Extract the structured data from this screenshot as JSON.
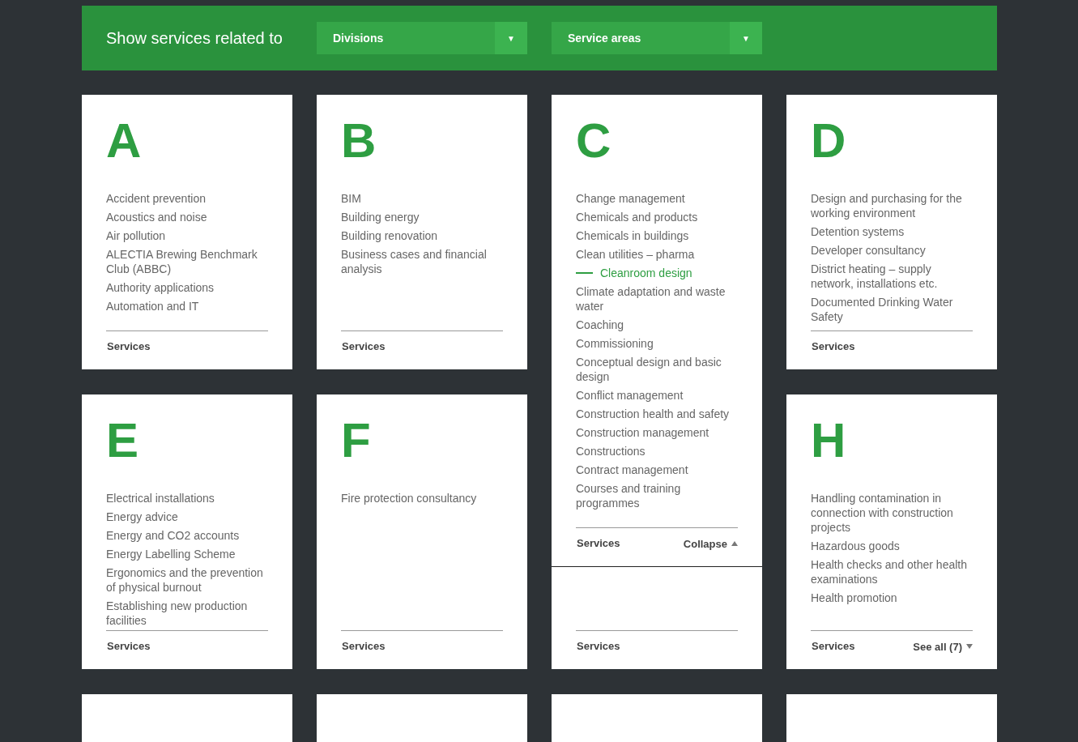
{
  "filter_bar": {
    "title": "Show services related to",
    "dropdowns": [
      {
        "label": "Divisions",
        "arrow": "▼"
      },
      {
        "label": "Service areas",
        "arrow": "▼"
      }
    ]
  },
  "cards": [
    {
      "letter": "A",
      "items": [
        {
          "label": "Accident prevention",
          "selected": false
        },
        {
          "label": "Acoustics and noise",
          "selected": false
        },
        {
          "label": "Air pollution",
          "selected": false
        },
        {
          "label": "ALECTIA Brewing Benchmark Club (ABBC)",
          "selected": false
        },
        {
          "label": "Authority applications",
          "selected": false
        },
        {
          "label": "Automation and IT",
          "selected": false
        }
      ],
      "footer": {
        "link": "Services"
      }
    },
    {
      "letter": "B",
      "items": [
        {
          "label": "BIM",
          "selected": false
        },
        {
          "label": "Building energy",
          "selected": false
        },
        {
          "label": "Building renovation",
          "selected": false
        },
        {
          "label": "Business cases and financial analysis",
          "selected": false
        }
      ],
      "footer": {
        "link": "Services"
      }
    },
    {
      "letter": "C",
      "items": [
        {
          "label": "Change management",
          "selected": false
        },
        {
          "label": "Chemicals and products",
          "selected": false
        },
        {
          "label": "Chemicals in buildings",
          "selected": false
        },
        {
          "label": "Clean utilities – pharma",
          "selected": false
        },
        {
          "label": "Cleanroom design",
          "selected": true
        },
        {
          "label": "Climate adaptation and waste water",
          "selected": false
        },
        {
          "label": "Coaching",
          "selected": false
        },
        {
          "label": "Commissioning",
          "selected": false
        },
        {
          "label": "Conceptual design and basic design",
          "selected": false
        },
        {
          "label": "Conflict management",
          "selected": false
        },
        {
          "label": "Construction health and safety",
          "selected": false
        },
        {
          "label": "Construction management",
          "selected": false
        },
        {
          "label": "Constructions",
          "selected": false
        },
        {
          "label": "Contract management",
          "selected": false
        },
        {
          "label": "Courses and training programmes",
          "selected": false
        }
      ],
      "footer": {
        "link": "Services",
        "toggle": {
          "label": "Collapse",
          "expanded": true
        }
      }
    },
    {
      "letter": "D",
      "items": [
        {
          "label": "Design and purchasing for the working environment",
          "selected": false
        },
        {
          "label": "Detention systems",
          "selected": false
        },
        {
          "label": "Developer consultancy",
          "selected": false
        },
        {
          "label": "District heating – supply network, installations etc.",
          "selected": false
        },
        {
          "label": "Documented Drinking Water Safety",
          "selected": false
        }
      ],
      "footer": {
        "link": "Services"
      }
    },
    {
      "letter": "E",
      "items": [
        {
          "label": "Electrical installations",
          "selected": false
        },
        {
          "label": "Energy advice",
          "selected": false
        },
        {
          "label": "Energy and CO2 accounts",
          "selected": false
        },
        {
          "label": "Energy Labelling Scheme",
          "selected": false
        },
        {
          "label": "Ergonomics and the prevention of physical burnout",
          "selected": false
        },
        {
          "label": "Establishing new production facilities",
          "selected": false
        }
      ],
      "footer": {
        "link": "Services"
      }
    },
    {
      "letter": "F",
      "items": [
        {
          "label": "Fire protection consultancy",
          "selected": false
        }
      ],
      "footer": {
        "link": "Services"
      }
    },
    {
      "kind": "covered",
      "footer": {
        "link": "Services"
      }
    },
    {
      "letter": "H",
      "items": [
        {
          "label": "Handling contamination in connection with construction projects",
          "selected": false
        },
        {
          "label": "Hazardous goods",
          "selected": false
        },
        {
          "label": "Health checks and other health examinations",
          "selected": false
        },
        {
          "label": "Health promotion",
          "selected": false
        }
      ],
      "footer": {
        "link": "Services",
        "toggle": {
          "label": "See all (7)",
          "expanded": false
        }
      }
    },
    {
      "kind": "cut-off"
    },
    {
      "kind": "cut-off"
    },
    {
      "kind": "cut-off"
    },
    {
      "kind": "cut-off"
    }
  ]
}
